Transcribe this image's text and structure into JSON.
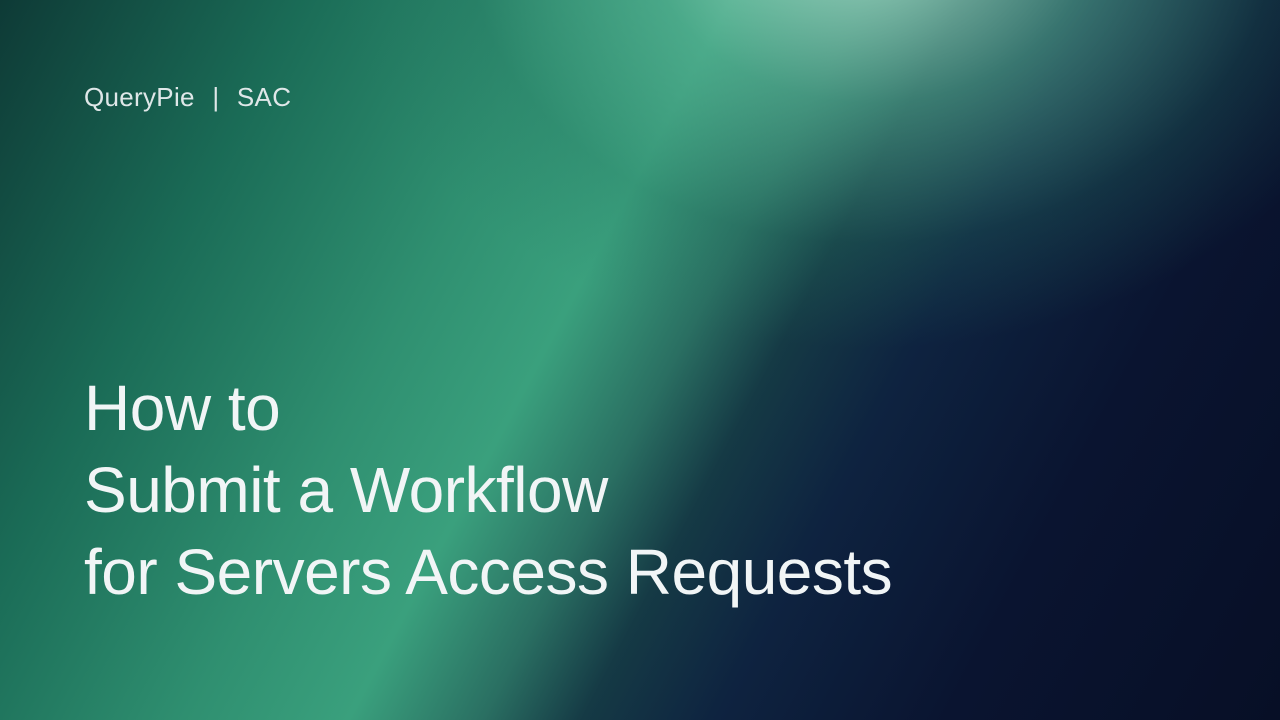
{
  "breadcrumb": {
    "product": "QueryPie",
    "separator": "|",
    "section": "SAC"
  },
  "title": {
    "line1": "How to",
    "line2": "Submit a Workflow",
    "line3": "for Servers Access Requests"
  }
}
